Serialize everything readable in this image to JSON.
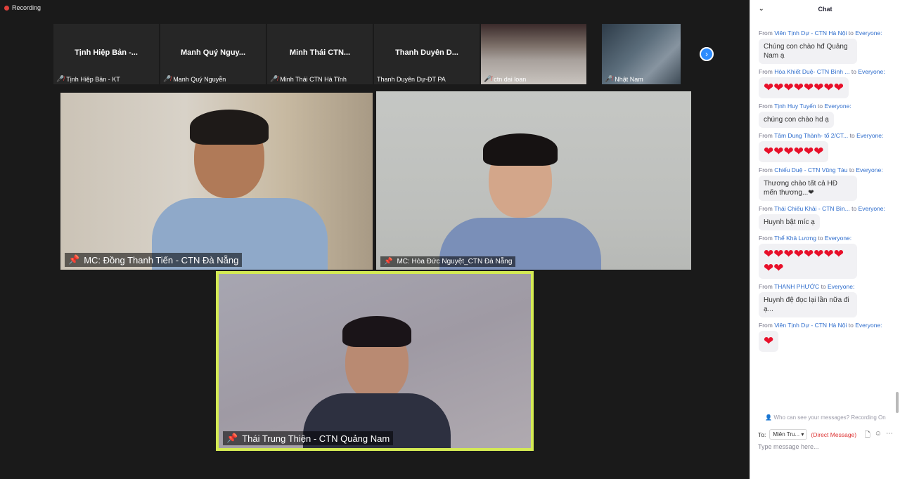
{
  "recording": {
    "label": "Recording"
  },
  "thumbnails": [
    {
      "big": "Tịnh Hiệp Bản -...",
      "caption": "Tịnh Hiệp Bản - KT",
      "muted": true
    },
    {
      "big": "Manh Quý Nguy...",
      "caption": "Manh Quý Nguyễn",
      "muted": true
    },
    {
      "big": "Minh Thái CTN...",
      "caption": "Minh Thái CTN Hà Tĩnh",
      "muted": true
    },
    {
      "big": "Thanh Duyên D...",
      "caption": "Thanh Duyên Dự-ĐT PA",
      "muted": false
    },
    {
      "big": "",
      "caption": "ctn dai loan",
      "muted": true
    },
    {
      "big": "",
      "caption": "Nhật Nam",
      "muted": true
    }
  ],
  "tiles": {
    "t1": {
      "name": "MC: Đồng Thanh Tiến - CTN Đà Nẵng"
    },
    "t2": {
      "name": "MC: Hòa Đức Nguyệt_CTN Đà Nẵng"
    },
    "t3": {
      "name": "Thái Trung Thiện - CTN Quảng Nam"
    }
  },
  "chat": {
    "title": "Chat",
    "messages": [
      {
        "from": "From",
        "sender": "Viên Tịnh Dự - CTN Hà Nội",
        "to": "to",
        "recipient": "Everyone:",
        "text": "Chúng con chào hđ Quảng Nam ạ"
      },
      {
        "from": "From",
        "sender": "Hòa Khiết Duệ- CTN Bình ...",
        "to": "to",
        "recipient": "Everyone:",
        "text": "❤❤❤❤❤❤❤❤",
        "hearts": true
      },
      {
        "from": "From",
        "sender": "Tịnh Huy Tuyến",
        "to": "to",
        "recipient": "Everyone:",
        "text": "chúng con chào hd ạ"
      },
      {
        "from": "From",
        "sender": "Tâm Dung Thành- tổ 2/CT...",
        "to": "to",
        "recipient": "Everyone:",
        "text": "❤❤❤❤❤❤",
        "hearts": true
      },
      {
        "from": "From",
        "sender": "Chiếu Duệ - CTN Vũng Tàu",
        "to": "to",
        "recipient": "Everyone:",
        "text": "Thương chào tất cả HĐ mến thương...❤"
      },
      {
        "from": "From",
        "sender": "Thái Chiếu Khải - CTN Bìn...",
        "to": "to",
        "recipient": "Everyone:",
        "text": "Huynh bật míc ạ"
      },
      {
        "from": "From",
        "sender": "Thể Khả Lương",
        "to": "to",
        "recipient": "Everyone:",
        "text": "❤❤❤❤❤❤❤❤❤❤",
        "hearts": true
      },
      {
        "from": "From",
        "sender": "THANH PHƯỚC",
        "to": "to",
        "recipient": "Everyone:",
        "text": "Huynh đệ đọc lại lần nữa đi ạ..."
      },
      {
        "from": "From",
        "sender": "Viên Tịnh Dự - CTN Hà Nội",
        "to": "to",
        "recipient": "Everyone:",
        "text": "❤",
        "hearts": true
      }
    ],
    "who_can_see": "Who can see your messages? Recording On",
    "to_label": "To:",
    "to_value": "Miên Tru...",
    "direct_message": "(Direct Message)",
    "placeholder": "Type message here..."
  },
  "colors": {
    "accent": "#2d8cff",
    "active_speaker": "#d4ea54",
    "muted": "#e0413c",
    "heart": "#e8102a"
  }
}
